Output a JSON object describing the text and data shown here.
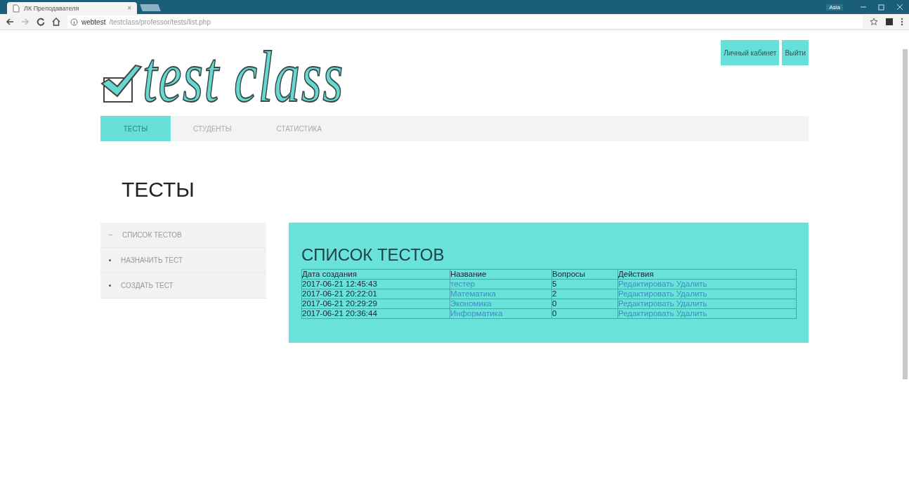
{
  "browser": {
    "tab_title": "ЛК Преподавателя",
    "close": "×",
    "user": "Asia",
    "url_host": "webtest",
    "url_path": "/testclass/professor/tests/list.php"
  },
  "logo": {
    "text": "test class"
  },
  "header_buttons": [
    {
      "label": "Личный кабинет"
    },
    {
      "label": "Выйти"
    }
  ],
  "nav": [
    {
      "label": "ТЕСТЫ",
      "selected": true
    },
    {
      "label": "СТУДЕНТЫ",
      "selected": false
    },
    {
      "label": "СТАТИСТИКА",
      "selected": false
    }
  ],
  "page_title": "ТЕСТЫ",
  "sidebar": [
    {
      "label": "СПИСОК ТЕСТОВ",
      "selected": true
    },
    {
      "label": "НАЗНАЧИТЬ ТЕСТ",
      "selected": false
    },
    {
      "label": "СОЗДАТЬ ТЕСТ",
      "selected": false
    }
  ],
  "panel": {
    "title": "СПИСОК ТЕСТОВ",
    "columns": [
      "Дата создания",
      "Название",
      "Вопросы",
      "Действия"
    ],
    "rows": [
      {
        "date": "2017-06-21 12:45:43",
        "name": "тестер",
        "questions": "5",
        "actions": [
          "Редактировать",
          "Удалить"
        ]
      },
      {
        "date": "2017-06-21 20:22:01",
        "name": "Математика",
        "questions": "2",
        "actions": [
          "Редактировать",
          "Удалить"
        ]
      },
      {
        "date": "2017-06-21 20:29:29",
        "name": "Экономика",
        "questions": "0",
        "actions": [
          "Редактировать",
          "Удалить"
        ]
      },
      {
        "date": "2017-06-21 20:36:44",
        "name": "Информатика",
        "questions": "0",
        "actions": [
          "Редактировать",
          "Удалить"
        ]
      }
    ]
  }
}
